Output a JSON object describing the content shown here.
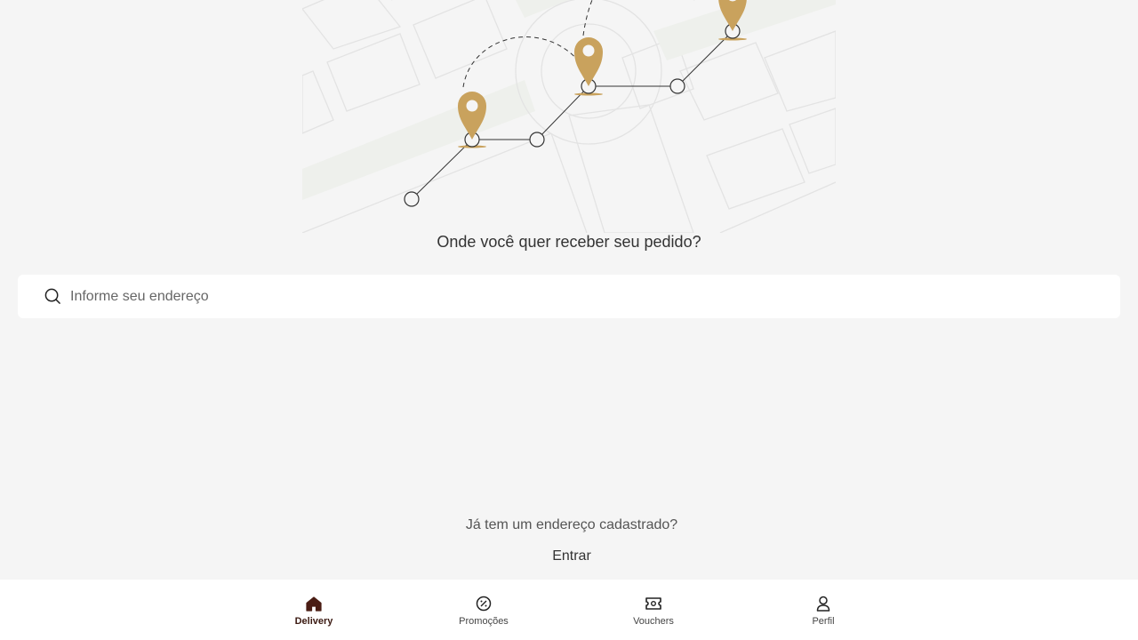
{
  "colors": {
    "accent": "#c9a25d",
    "active_nav": "#4a1d14",
    "background": "#f5f5f5"
  },
  "main": {
    "question": "Onde você quer receber seu pedido?",
    "search": {
      "placeholder": "Informe seu endereço",
      "value": ""
    },
    "registered_prompt": "Já tem um endereço cadastrado?",
    "login_label": "Entrar"
  },
  "bottom_nav": {
    "items": [
      {
        "label": "Delivery",
        "icon": "home-icon",
        "active": true
      },
      {
        "label": "Promoções",
        "icon": "discount-badge-icon",
        "active": false
      },
      {
        "label": "Vouchers",
        "icon": "ticket-icon",
        "active": false
      },
      {
        "label": "Perfil",
        "icon": "user-icon",
        "active": false
      }
    ]
  }
}
